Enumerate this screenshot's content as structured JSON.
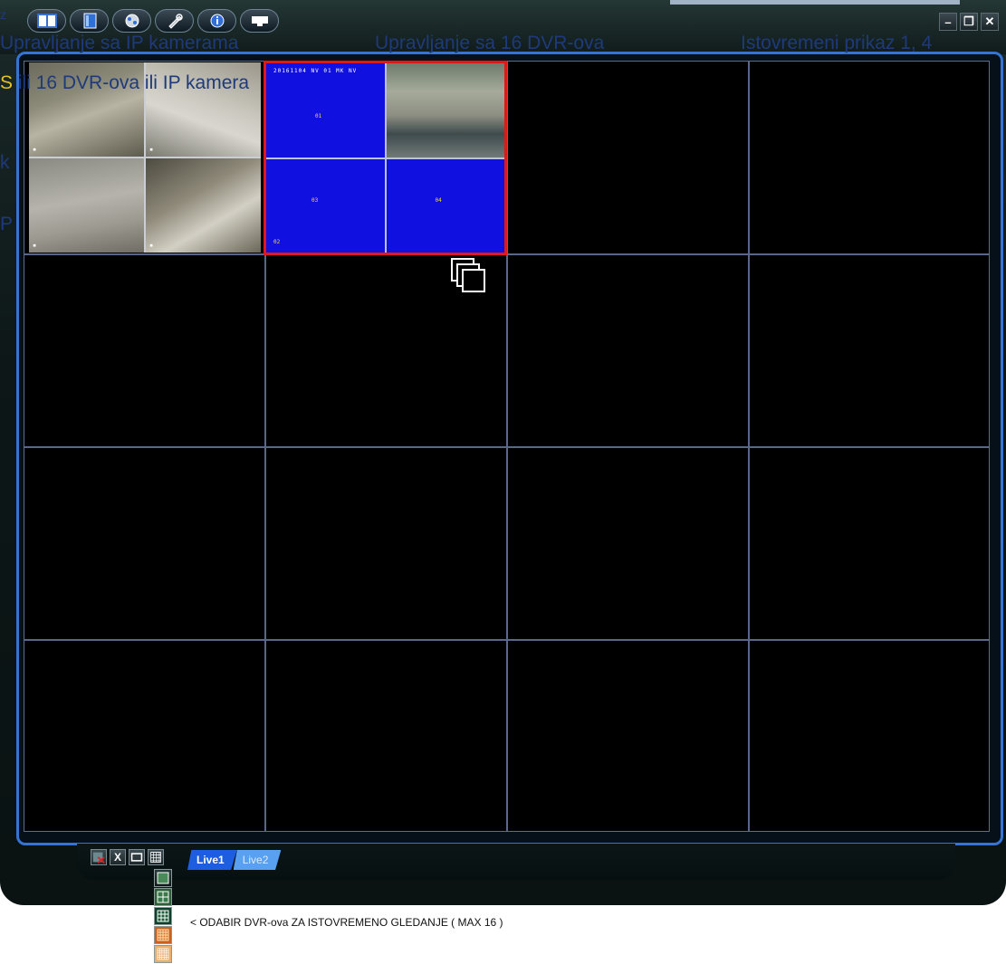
{
  "captions": {
    "ip_cameras": "Upravljanje sa IP kamerama",
    "dvr16": "Upravljanje sa 16 DVR-ova",
    "simultaneous": "Istovremeni prikaz 1, 4",
    "line2_lead": "S",
    "line2": "ili 16 DVR-ova ili IP kamera"
  },
  "left_fragments": {
    "f1": "z",
    "f2": "k",
    "f3": "P"
  },
  "toolbar": {
    "buttons": [
      "layout-icon",
      "book-icon",
      "network-icon",
      "tools-icon",
      "info-icon",
      "keyboard-icon"
    ]
  },
  "window_controls": {
    "minimize": "–",
    "restore": "❐",
    "close": "✕"
  },
  "tiles": {
    "tile2_top_osd": "20161104 NV 01 MK NV",
    "blue_labels": [
      "01",
      "02",
      "03",
      "04"
    ]
  },
  "bottom": {
    "icons": [
      "record-icon",
      "close-all-icon",
      "single-view-icon",
      "grid-view-icon"
    ],
    "close_glyph": "X",
    "tabs": [
      {
        "label": "Live1",
        "active": true
      },
      {
        "label": "Live2",
        "active": false
      }
    ]
  },
  "note": "< ODABIR DVR-ova ZA ISTOVREMENO GLEDANJE ( MAX 16 )",
  "colors": {
    "frame": "#3574d4",
    "grid_line": "#59688a",
    "selected_border": "#e01818",
    "no_signal": "#1010e0",
    "caption": "#1e3a7a"
  }
}
